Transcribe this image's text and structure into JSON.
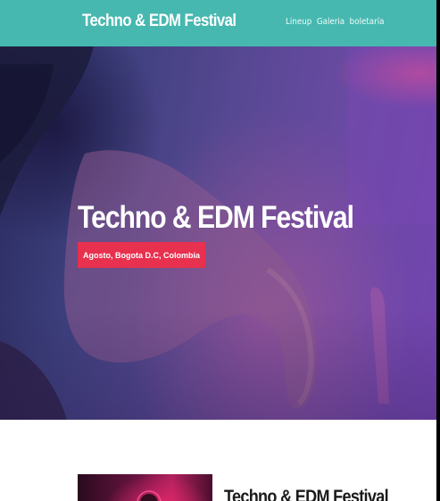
{
  "navbar": {
    "brand": "Techno & EDM Festival",
    "links": [
      "Lineup",
      "Galeria",
      "boletaría"
    ],
    "background": "#46b8b0"
  },
  "hero": {
    "title": "Techno & EDM Festival",
    "badge": "Agosto, Bogota D.C, Colombia",
    "badge_color": "#e8304f"
  },
  "about": {
    "title": "Techno & EDM Festival"
  }
}
